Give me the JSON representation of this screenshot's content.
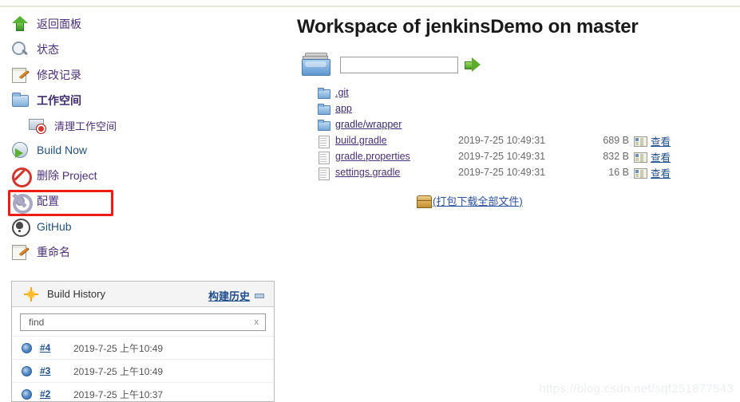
{
  "sidebar": {
    "items": [
      {
        "label": "返回面板",
        "icon": "up-arrow-icon",
        "style": "purple"
      },
      {
        "label": "状态",
        "icon": "search-icon",
        "style": "purple"
      },
      {
        "label": "修改记录",
        "icon": "notepad-pencil-icon",
        "style": "purple"
      },
      {
        "label": "工作空间",
        "icon": "folder-icon",
        "style": "bold"
      },
      {
        "label": "清理工作空间",
        "icon": "folder-forbidden-icon",
        "style": "sub"
      },
      {
        "label": "Build Now",
        "icon": "build-now-icon",
        "style": "blue"
      },
      {
        "label": "删除 Project",
        "icon": "forbidden-icon",
        "style": "purple"
      },
      {
        "label": "配置",
        "icon": "gear-icon",
        "style": "purple"
      },
      {
        "label": "GitHub",
        "icon": "github-icon",
        "style": "blue"
      },
      {
        "label": "重命名",
        "icon": "notepad-pencil-icon",
        "style": "purple"
      }
    ],
    "highlight_index": 7,
    "highlight_color": "#ee1c15"
  },
  "build_history": {
    "title": "Build History",
    "locale_link": "构建历史",
    "sun_icon": "sun-icon",
    "minimize_icon": "minimize-icon",
    "find": {
      "value": "find",
      "placeholder": "find",
      "clear_label": "x"
    },
    "builds": [
      {
        "number": "#4",
        "date": "2019-7-25 上午10:49",
        "status": "blue-ball"
      },
      {
        "number": "#3",
        "date": "2019-7-25 上午10:49",
        "status": "blue-ball"
      },
      {
        "number": "#2",
        "date": "2019-7-25 上午10:37",
        "status": "blue-ball"
      }
    ]
  },
  "main": {
    "title": "Workspace of jenkinsDemo on master",
    "path_input": {
      "value": "",
      "placeholder": ""
    },
    "go_button_label": "",
    "entries": [
      {
        "name": ".git",
        "type": "dir",
        "date": "",
        "size": "",
        "view": ""
      },
      {
        "name": "app",
        "type": "dir",
        "date": "",
        "size": "",
        "view": ""
      },
      {
        "name": "gradle/wrapper",
        "type": "dir",
        "date": "",
        "size": "",
        "view": ""
      },
      {
        "name": "build.gradle",
        "type": "file",
        "date": "2019-7-25 10:49:31",
        "size": "689 B",
        "view": "查看"
      },
      {
        "name": "gradle.properties",
        "type": "file",
        "date": "2019-7-25 10:49:31",
        "size": "832 B",
        "view": "查看"
      },
      {
        "name": "settings.gradle",
        "type": "file",
        "date": "2019-7-25 10:49:31",
        "size": "16 B",
        "view": "查看"
      }
    ],
    "download_all": "(打包下载全部文件)",
    "download_icon": "archive-icon"
  },
  "watermark": "https://blog.csdn.net/sqf251877543",
  "colors": {
    "link_visited": "#4b2f7a",
    "link_blue": "#1f4e8c",
    "highlight": "#ee1c15",
    "muted_text": "#6a6a6a"
  }
}
